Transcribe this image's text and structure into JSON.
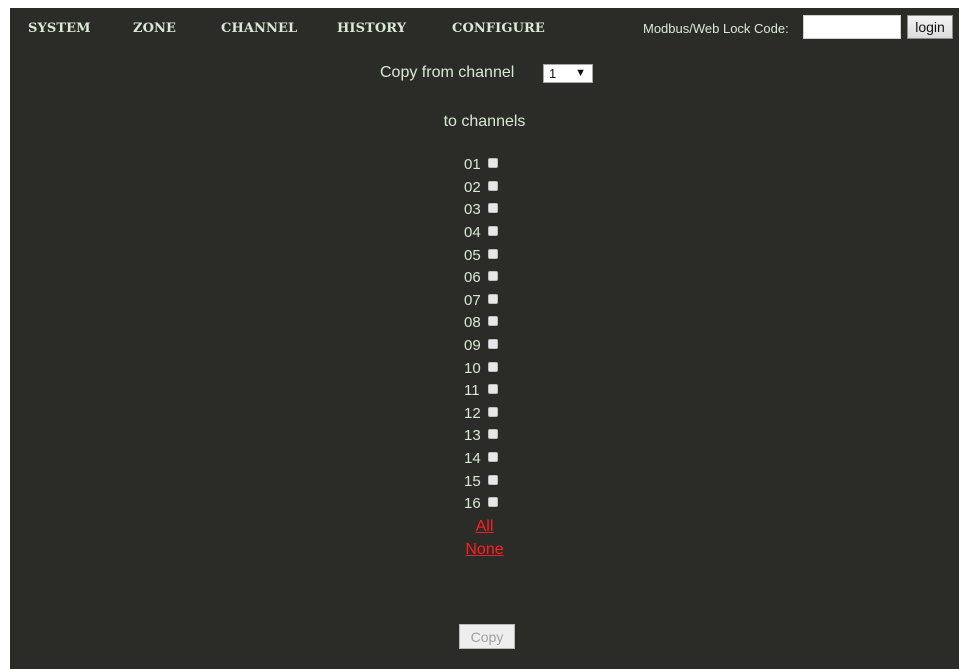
{
  "nav": {
    "items": [
      {
        "label": "SYSTEM"
      },
      {
        "label": "ZONE"
      },
      {
        "label": "CHANNEL"
      },
      {
        "label": "HISTORY"
      },
      {
        "label": "CONFIGURE"
      }
    ],
    "lock_label": "Modbus/Web Lock Code:",
    "lock_value": "",
    "login_label": "login"
  },
  "copy": {
    "from_label": "Copy from channel",
    "selected_channel": "1",
    "select_caret": "▼",
    "to_label": "to channels",
    "channels": [
      {
        "label": "01"
      },
      {
        "label": "02"
      },
      {
        "label": "03"
      },
      {
        "label": "04"
      },
      {
        "label": "05"
      },
      {
        "label": "06"
      },
      {
        "label": "07"
      },
      {
        "label": "08"
      },
      {
        "label": "09"
      },
      {
        "label": "10"
      },
      {
        "label": "11"
      },
      {
        "label": "12"
      },
      {
        "label": "13"
      },
      {
        "label": "14"
      },
      {
        "label": "15"
      },
      {
        "label": "16"
      }
    ],
    "all_label": "All",
    "none_label": "None",
    "copy_button_label": "Copy"
  },
  "colors": {
    "panel_background": "#2b2b28",
    "text": "#d9e8d3",
    "link_red": "#ff1f1f"
  }
}
